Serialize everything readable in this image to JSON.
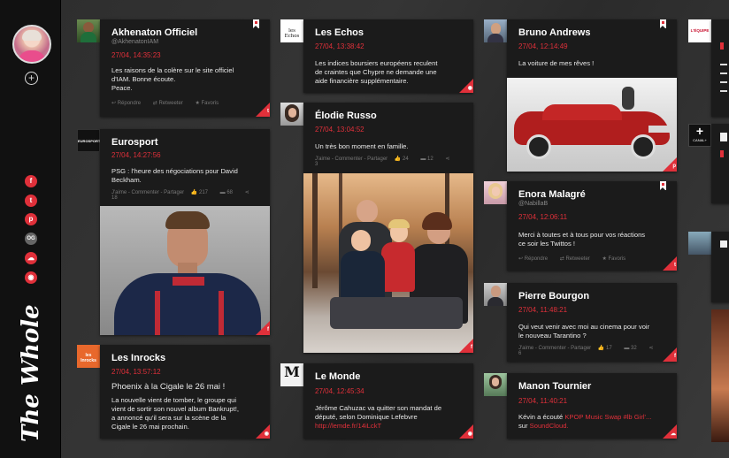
{
  "app": {
    "brand": "The Whole"
  },
  "sidebar": {
    "add_icon": "plus-circle-icon",
    "socials": [
      {
        "name": "facebook",
        "glyph": "f",
        "color": "#e0303a"
      },
      {
        "name": "twitter",
        "glyph": "t",
        "color": "#e0303a"
      },
      {
        "name": "pinterest",
        "glyph": "p",
        "color": "#e0303a"
      },
      {
        "name": "og",
        "glyph": "OG",
        "color": "#666666"
      },
      {
        "name": "soundcloud",
        "glyph": "☁",
        "color": "#e0303a"
      },
      {
        "name": "rss",
        "glyph": "◉",
        "color": "#e0303a"
      }
    ]
  },
  "accent": "#e0303a",
  "cards": {
    "akhenaton": {
      "name": "Akhenaton Officiel",
      "handle": "@AkhenatonIAM",
      "date": "27/04, 14:35:23",
      "text": [
        "Les raisons de la colère sur le site officiel",
        "d'IAM. Bonne écoute.",
        "Peace."
      ],
      "actions": [
        "Répondre",
        "Retweeter",
        "Favoris"
      ]
    },
    "eurosport": {
      "name": "Eurosport",
      "date": "27/04, 14:27:56",
      "text": [
        "PSG : l'heure des négociations pour David",
        "Beckham."
      ],
      "actions": [
        "J'aime - Commenter - Partager",
        "217",
        "68",
        "18"
      ],
      "thumb_label": "EUROSPORT"
    },
    "inrocks": {
      "name": "Les Inrocks",
      "date": "27/04, 13:57:12",
      "title": "Phoenix à la Cigale le 26 mai !",
      "text": [
        "La nouvelle vient de tomber, le groupe qui",
        "vient de sortir son nouvel album Bankrupt!,",
        "a annoncé qu'il sera sur la scène de la",
        "Cigale le 26 mai prochain."
      ],
      "thumb_label": "les Inrocks"
    },
    "lesechos": {
      "name": "Les Echos",
      "date": "27/04, 13:38:42",
      "text": [
        "Les indices boursiers européens reculent",
        "de craintes que Chypre ne demande une",
        "aide financière supplémentaire."
      ],
      "thumb_label": "les Echos"
    },
    "elodie": {
      "name": "Élodie Russo",
      "date": "27/04, 13:04:52",
      "text": [
        "Un très bon moment en famille."
      ],
      "actions": [
        "J'aime - Commenter - Partager",
        "24",
        "12",
        "3"
      ]
    },
    "lemonde": {
      "name": "Le Monde",
      "date": "27/04, 12:45:34",
      "text": [
        "Jérôme Cahuzac va quitter son mandat de",
        "député, selon Dominique Lefebvre"
      ],
      "link": "http://lemde.fr/14iLckT",
      "thumb_label": "M"
    },
    "bruno": {
      "name": "Bruno Andrews",
      "date": "27/04, 12:14:49",
      "text": [
        "La voiture de mes rêves !"
      ]
    },
    "enora": {
      "name": "Enora Malagré",
      "handle": "@NabillaB",
      "date": "27/04, 12:06:11",
      "text": [
        "Merci à toutes et à tous pour vos réactions",
        "ce soir les Twittos !"
      ],
      "actions": [
        "Répondre",
        "Retweeter",
        "Favoris"
      ]
    },
    "pierre": {
      "name": "Pierre Bourgon",
      "date": "27/04, 11:48:21",
      "text": [
        "Qui veut venir avec moi au cinema pour voir",
        "le nouveau Tarantino ?"
      ],
      "actions": [
        "J'aime - Commenter - Partager",
        "17",
        "32",
        "6"
      ]
    },
    "manon": {
      "name": "Manon Tournier",
      "date": "27/04, 11:40:21",
      "text_plain": "Kévin a écouté ",
      "text_link": "KPOP Music Swap #lb Girl'...",
      "text2_plain": "sur ",
      "text2_link": "SoundCloud."
    }
  },
  "edge": {
    "lequipe_label": "L'ÉQUIPE",
    "canal_label": "CANAL+"
  }
}
